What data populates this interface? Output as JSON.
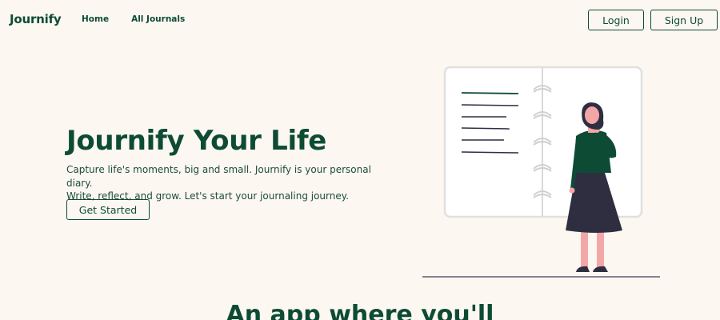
{
  "nav": {
    "brand": "Journify",
    "links": [
      "Home",
      "All Journals"
    ],
    "login_label": "Login",
    "signup_label": "Sign Up"
  },
  "hero": {
    "title": "Journify Your Life",
    "subtitle_line1": "Capture life's moments, big and small. Journify is your personal diary.",
    "subtitle_line2": "Write, reflect, and grow. Let's start your journaling journey.",
    "cta_label": "Get Started"
  },
  "section": {
    "title": "An app where you'll"
  },
  "colors": {
    "accent": "#0d4b35",
    "background": "#fcf7f0"
  }
}
